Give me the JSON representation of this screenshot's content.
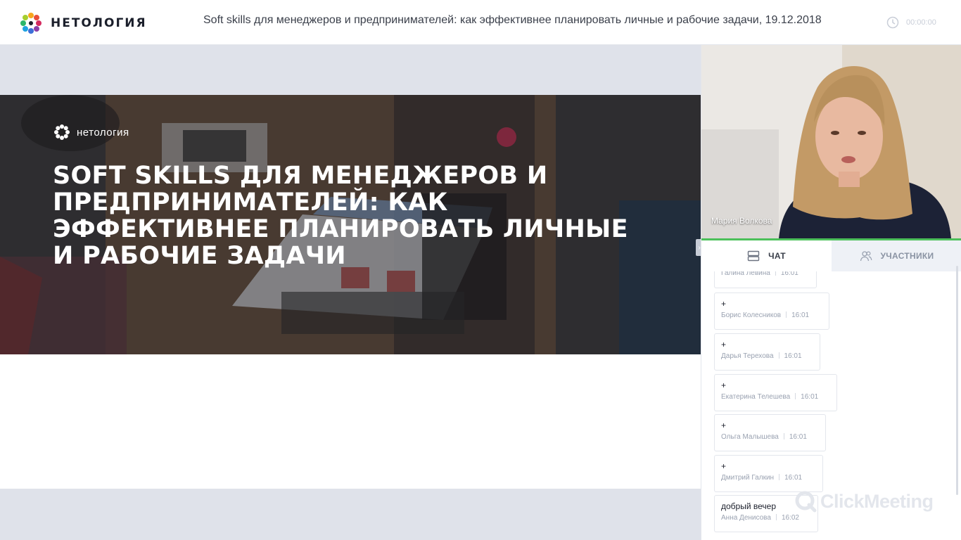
{
  "header": {
    "brand_name": "НЕТОЛОГИЯ",
    "webinar_title": "Soft skills для менеджеров и предпринимателей: как эффективнее планировать личные и рабочие задачи, 19.12.2018",
    "timer": "00:00:00"
  },
  "slide": {
    "logo_text": "нетология",
    "heading": "SOFT SKILLS ДЛЯ МЕНЕДЖЕРОВ И ПРЕДПРИНИМАТЕЛЕЙ: КАК ЭФФЕКТИВНЕЕ ПЛАНИРОВАТЬ ЛИЧНЫЕ И РАБОЧИЕ ЗАДАЧИ"
  },
  "video": {
    "presenter_name": "Мария Волкова"
  },
  "tabs": {
    "chat": "ЧАТ",
    "participants": "УЧАСТНИКИ"
  },
  "chat": {
    "messages": [
      {
        "text": "",
        "author": "Галина Левина",
        "time": "16:01"
      },
      {
        "text": "+",
        "author": "Борис Колесников",
        "time": "16:01"
      },
      {
        "text": "+",
        "author": "Дарья Терехова",
        "time": "16:01"
      },
      {
        "text": "+",
        "author": "Екатерина Телешева",
        "time": "16:01"
      },
      {
        "text": "+",
        "author": "Ольга Малышева",
        "time": "16:01"
      },
      {
        "text": "+",
        "author": "Дмитрий Галкин",
        "time": "16:01"
      },
      {
        "text": "добрый вечер",
        "author": "Анна Денисова",
        "time": "16:02"
      }
    ]
  },
  "watermark": "ClickMeeting",
  "colors": {
    "accent_green": "#4cc05a",
    "stage_band": "#dfe2ea",
    "tab_inactive": "#eef1f6"
  }
}
